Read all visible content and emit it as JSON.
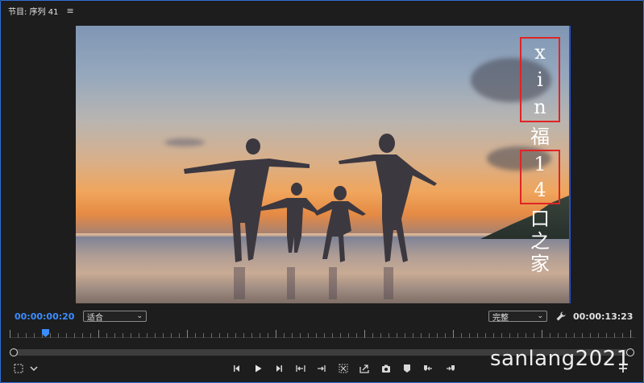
{
  "panel": {
    "title": "节目: 序列 41",
    "menu_icon": "hamburger-icon"
  },
  "video": {
    "watermark_box_top": [
      "x",
      "i",
      "n"
    ],
    "watermark_char_fu": "福",
    "watermark_box_mid": [
      "1",
      "4"
    ],
    "watermark_tail": [
      "口",
      "之",
      "家"
    ]
  },
  "controls": {
    "current_time": "00:00:00:20",
    "fit_select": "适合",
    "quality_select": "完整",
    "duration": "00:00:13:23",
    "settings_icon": "wrench-icon"
  },
  "transport": {
    "buttons": [
      "safe-margins-icon",
      "chevron-down-icon",
      "add-marker-icon",
      "play-icon",
      "step-forward-icon",
      "go-to-in-icon",
      "go-to-out-icon",
      "insert-icon",
      "overwrite-icon",
      "export-frame-icon",
      "marker-icon",
      "step-back-icon",
      "lift-icon",
      "add-button-icon"
    ]
  },
  "overlay": {
    "username": "sanlang2021"
  },
  "colors": {
    "accent": "#3b8dff",
    "frame_border": "#2e6fd6",
    "watermark_box": "#e02424",
    "background": "#1d1d1d"
  }
}
